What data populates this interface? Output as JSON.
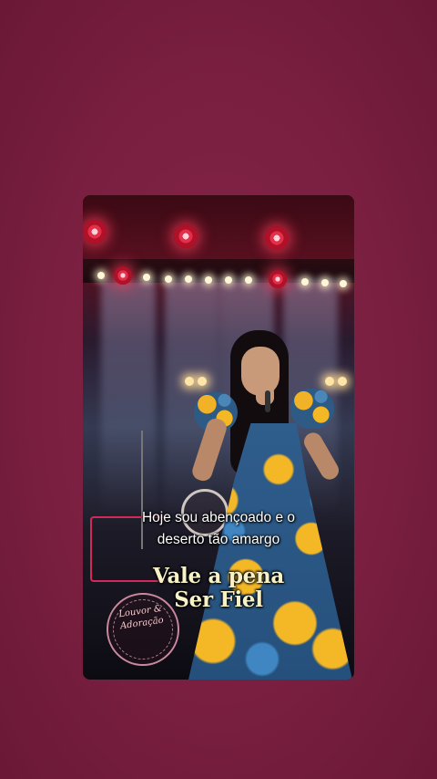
{
  "video": {
    "lyric_line1": "Hoje sou abençoado e o",
    "lyric_line2": "deserto tão amargo",
    "title_line1": "Vale a  pena",
    "title_line2": "Ser Fiel",
    "logo_line1": "Louvor &",
    "logo_line2": "Adoração"
  },
  "colors": {
    "background": "#7a1e3f",
    "title_text": "#f7f1c6",
    "lyric_text": "#ffffff",
    "accent_red": "#e0304a",
    "dress_blue": "#2f5d8c",
    "dress_yellow": "#f4b726"
  }
}
